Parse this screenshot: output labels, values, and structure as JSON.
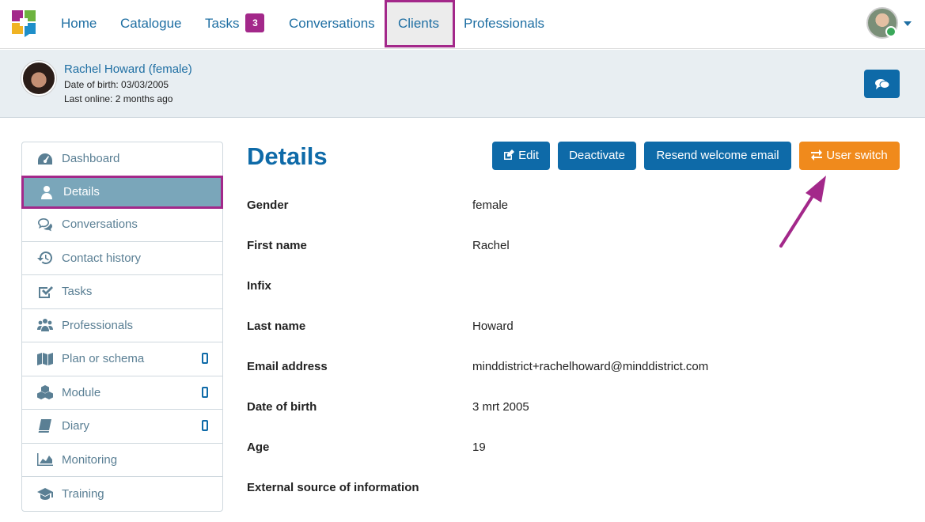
{
  "nav": {
    "items": [
      "Home",
      "Catalogue",
      "Tasks",
      "Conversations",
      "Clients",
      "Professionals"
    ],
    "tasks_badge": "3"
  },
  "client": {
    "name": "Rachel Howard (female)",
    "dob": "Date of birth: 03/03/2005",
    "last_online": "Last online: 2 months ago"
  },
  "sidebar": {
    "items": [
      {
        "label": "Dashboard",
        "icon": "dashboard-icon"
      },
      {
        "label": "Details",
        "icon": "user-icon"
      },
      {
        "label": "Conversations",
        "icon": "conversations-icon"
      },
      {
        "label": "Contact history",
        "icon": "history-icon"
      },
      {
        "label": "Tasks",
        "icon": "check-icon"
      },
      {
        "label": "Professionals",
        "icon": "users-icon"
      },
      {
        "label": "Plan or schema",
        "icon": "map-icon"
      },
      {
        "label": "Module",
        "icon": "cubes-icon"
      },
      {
        "label": "Diary",
        "icon": "book-icon"
      },
      {
        "label": "Monitoring",
        "icon": "chart-icon"
      },
      {
        "label": "Training",
        "icon": "graduation-cap-icon"
      }
    ]
  },
  "main": {
    "title": "Details",
    "buttons": {
      "edit": "Edit",
      "deactivate": "Deactivate",
      "resend": "Resend welcome email",
      "user_switch": "User switch"
    },
    "fields": [
      {
        "label": "Gender",
        "value": "female"
      },
      {
        "label": "First name",
        "value": "Rachel"
      },
      {
        "label": "Infix",
        "value": ""
      },
      {
        "label": "Last name",
        "value": "Howard"
      },
      {
        "label": "Email address",
        "value": "minddistrict+rachelhoward@minddistrict.com"
      },
      {
        "label": "Date of birth",
        "value": "3 mrt 2005"
      },
      {
        "label": "Age",
        "value": "19"
      },
      {
        "label": "External source of information",
        "value": ""
      }
    ]
  },
  "colors": {
    "primary": "#0e6aa8",
    "accent": "#a3288a",
    "orange": "#f08a1c",
    "sidebar_active": "#7aa6ba"
  }
}
